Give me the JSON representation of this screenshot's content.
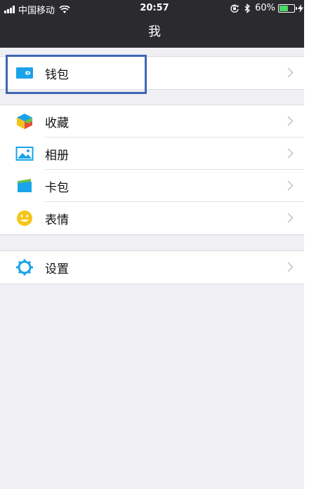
{
  "status_bar": {
    "carrier": "中国移动",
    "time": "20:57",
    "battery_percent": "60%",
    "battery_level": 0.6,
    "icons": [
      "signal-icon",
      "wifi-icon",
      "rotation-lock-icon",
      "bluetooth-icon",
      "battery-icon",
      "charging-icon"
    ]
  },
  "nav": {
    "title": "我"
  },
  "groups": {
    "wallet": {
      "label": "钱包",
      "icon": "wallet-icon"
    },
    "favorites": {
      "label": "收藏",
      "icon": "favorites-cube-icon"
    },
    "album": {
      "label": "相册",
      "icon": "album-icon"
    },
    "cards": {
      "label": "卡包",
      "icon": "card-holder-icon"
    },
    "stickers": {
      "label": "表情",
      "icon": "emoji-icon"
    },
    "settings": {
      "label": "设置",
      "icon": "settings-gear-icon"
    }
  },
  "colors": {
    "nav_bg": "#2b2b2f",
    "page_bg": "#efeff4",
    "highlight_border": "#3f66b4",
    "wallet_blue": "#1aa3e8",
    "battery_green": "#4cd964"
  }
}
